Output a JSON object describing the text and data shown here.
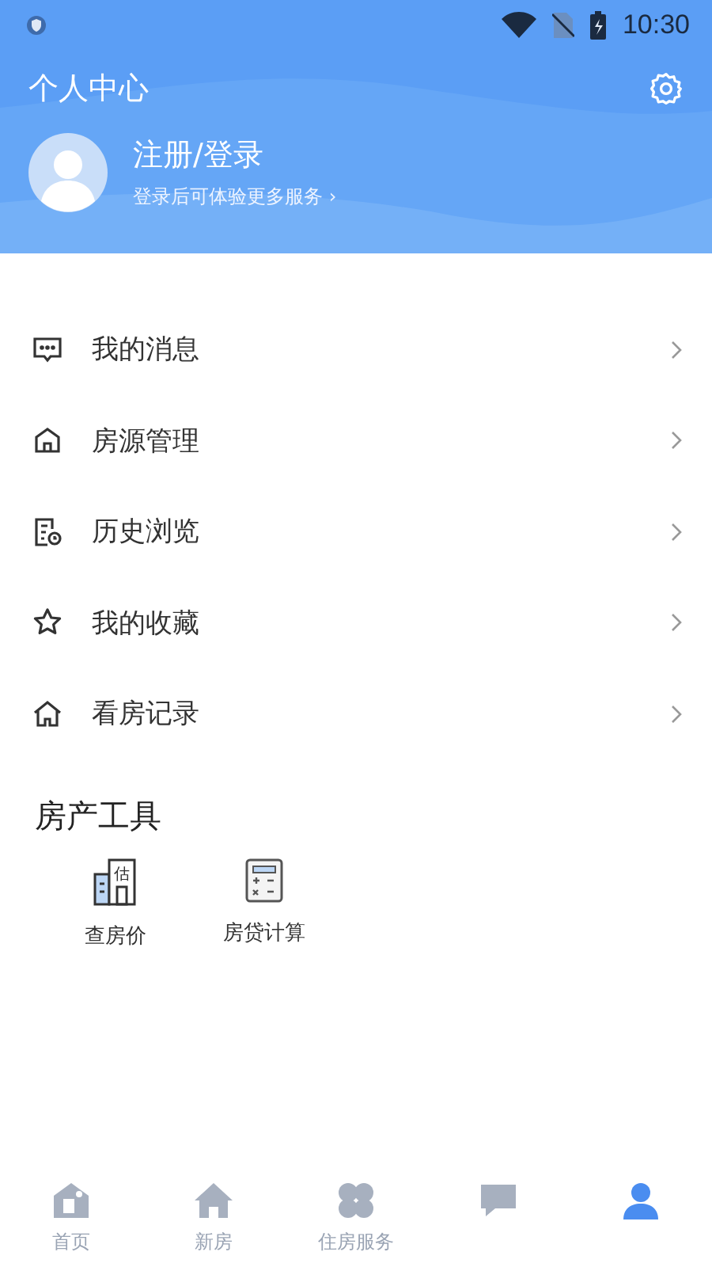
{
  "status_bar": {
    "time": "10:30"
  },
  "header": {
    "title": "个人中心",
    "login": {
      "title": "注册/登录",
      "subtitle": "登录后可体验更多服务 ›"
    }
  },
  "menu": [
    {
      "kind": "message",
      "label": "我的消息"
    },
    {
      "kind": "house",
      "label": "房源管理"
    },
    {
      "kind": "history",
      "label": "历史浏览"
    },
    {
      "kind": "star",
      "label": "我的收藏"
    },
    {
      "kind": "home",
      "label": "看房记录"
    }
  ],
  "tools": {
    "title": "房产工具",
    "items": [
      {
        "kind": "building",
        "label": "查房价",
        "badge": "估"
      },
      {
        "kind": "calculator",
        "label": "房贷计算"
      }
    ]
  },
  "tab_bar": [
    {
      "kind": "home",
      "label": "首页",
      "selected": false
    },
    {
      "kind": "house",
      "label": "新房",
      "selected": false
    },
    {
      "kind": "grid",
      "label": "住房服务",
      "selected": false
    },
    {
      "kind": "chat",
      "selected": false
    },
    {
      "kind": "person",
      "selected": true
    }
  ]
}
